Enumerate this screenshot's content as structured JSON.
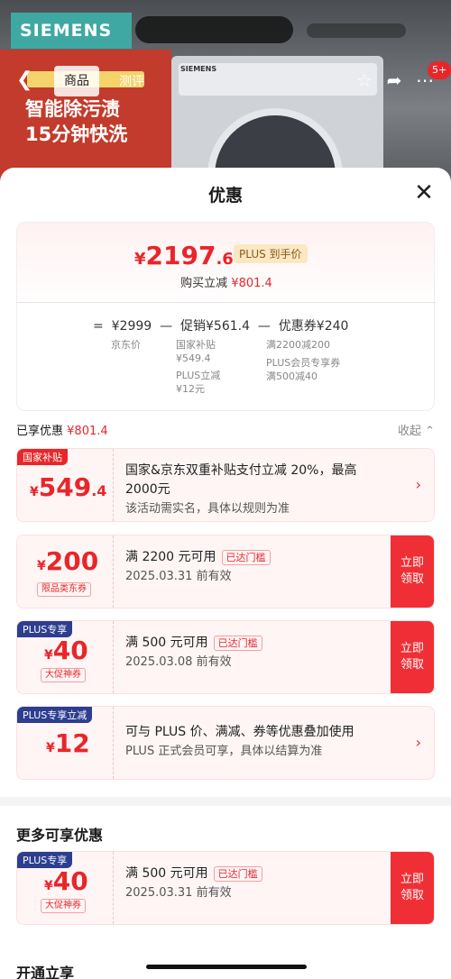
{
  "background": {
    "brand_logo": "SIEMENS",
    "washer_brand": "SIEMENS",
    "promo_line1": "智能除污渍",
    "promo_line2": "15分钟快洗",
    "tabs": {
      "goods": "商品",
      "evaluate": "测评"
    },
    "cart_badge": "5+",
    "icons": [
      "back-arrow-icon",
      "star-icon",
      "share-icon",
      "more-icon"
    ]
  },
  "sheet": {
    "title": "优惠",
    "price_card": {
      "currency": "¥",
      "price_int": "2197",
      "price_dec": ".6",
      "plus_tag": "PLUS 到手价",
      "purchase_label": "购买立减",
      "purchase_amount": "¥801.4",
      "formula": {
        "eq": "=",
        "jd_price": "¥2999",
        "minus1": "—",
        "promo": "促销¥561.4",
        "minus2": "—",
        "coupon": "优惠券¥240"
      },
      "sub_jd": "京东价",
      "sub_gov_label": "国家补贴",
      "sub_gov_value": "¥549.4",
      "sub_plus_label": "PLUS立减",
      "sub_plus_value": "¥12元",
      "sub_coupon1": "满2200减200",
      "sub_coupon2_label": "PLUS会员专享券",
      "sub_coupon2_value": "满500减40"
    },
    "enjoyed": {
      "label": "已享优惠",
      "amount": "¥801.4",
      "collapse": "收起"
    },
    "coupons": [
      {
        "tag": "国家补贴",
        "currency": "¥",
        "amount": "549",
        "decimal": ".4",
        "line1": "国家&京东双重补贴支付立减 20%，最高",
        "line2": "2000元",
        "line3": "该活动需实名，具体以规则为准"
      },
      {
        "currency": "¥",
        "amount": "200",
        "type": "限品类东券",
        "line1": "满 2200 元可用",
        "reach": "已达门槛",
        "line2": "2025.03.31 前有效",
        "claim": "立即\n领取"
      },
      {
        "tag": "PLUS专享",
        "currency": "¥",
        "amount": "40",
        "type": "大促神券",
        "line1": "满 500 元可用",
        "reach": "已达门槛",
        "line2": "2025.03.08 前有效",
        "claim": "立即\n领取"
      },
      {
        "tag": "PLUS专享立减",
        "currency": "¥",
        "amount": "12",
        "line1": "可与 PLUS 价、满减、券等优惠叠加使用",
        "line2": "PLUS 正式会员可享，具体以结算为准"
      }
    ],
    "more_title": "更多可享优惠",
    "more_coupon": {
      "tag": "PLUS专享",
      "currency": "¥",
      "amount": "40",
      "type": "大促神券",
      "line1": "满 500 元可用",
      "reach": "已达门槛",
      "line2": "2025.03.31 前有效",
      "claim": "立即\n领取"
    },
    "open_title": "开通立享"
  }
}
